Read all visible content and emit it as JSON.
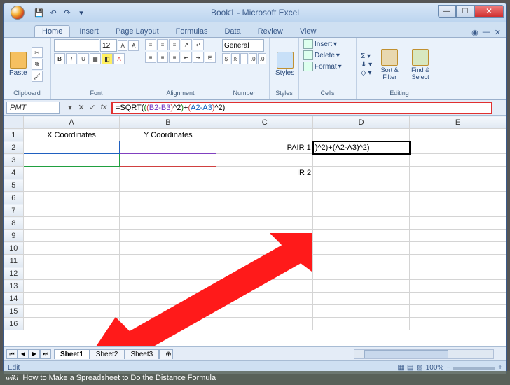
{
  "window": {
    "title": "Book1 - Microsoft Excel"
  },
  "tabs": [
    "Home",
    "Insert",
    "Page Layout",
    "Formulas",
    "Data",
    "Review",
    "View"
  ],
  "active_tab": "Home",
  "ribbon": {
    "clipboard": {
      "label": "Clipboard",
      "paste": "Paste"
    },
    "font": {
      "label": "Font",
      "name": "",
      "size": "12",
      "buttons": [
        "B",
        "I",
        "U"
      ]
    },
    "alignment": {
      "label": "Alignment"
    },
    "number": {
      "label": "Number",
      "format": "General"
    },
    "styles": {
      "label": "Styles",
      "btn": "Styles"
    },
    "cells": {
      "label": "Cells",
      "insert": "Insert",
      "delete": "Delete",
      "format": "Format"
    },
    "editing": {
      "label": "Editing",
      "sort": "Sort & Filter",
      "find": "Find & Select"
    }
  },
  "formula_bar": {
    "name_box": "PMT",
    "formula_parts": {
      "prefix": "=SQRT(",
      "g1a": "(",
      "g2a": "(",
      "ref1": "B2-B3",
      "g2b": ")",
      "mid1": "^2",
      "g1b": ")",
      "plus": "+",
      "g3a": "(",
      "ref2": "A2-A3",
      "g3b": ")",
      "mid2": "^2",
      "suffix": ")"
    }
  },
  "columns": [
    "A",
    "B",
    "C",
    "D",
    "E"
  ],
  "rows_visible": 16,
  "cells": {
    "A1": "X Coordinates",
    "B1": "Y Coordinates",
    "C2": "PAIR 1",
    "C4": "    IR 2",
    "D2": ")^2)+(A2-A3)^2)"
  },
  "sheets": [
    "Sheet1",
    "Sheet2",
    "Sheet3"
  ],
  "active_sheet": "Sheet1",
  "status": {
    "mode": "Edit",
    "zoom": "100%"
  },
  "caption": {
    "brand": "wiki",
    "text": "How to Make a Spreadsheet to Do the Distance Formula"
  }
}
